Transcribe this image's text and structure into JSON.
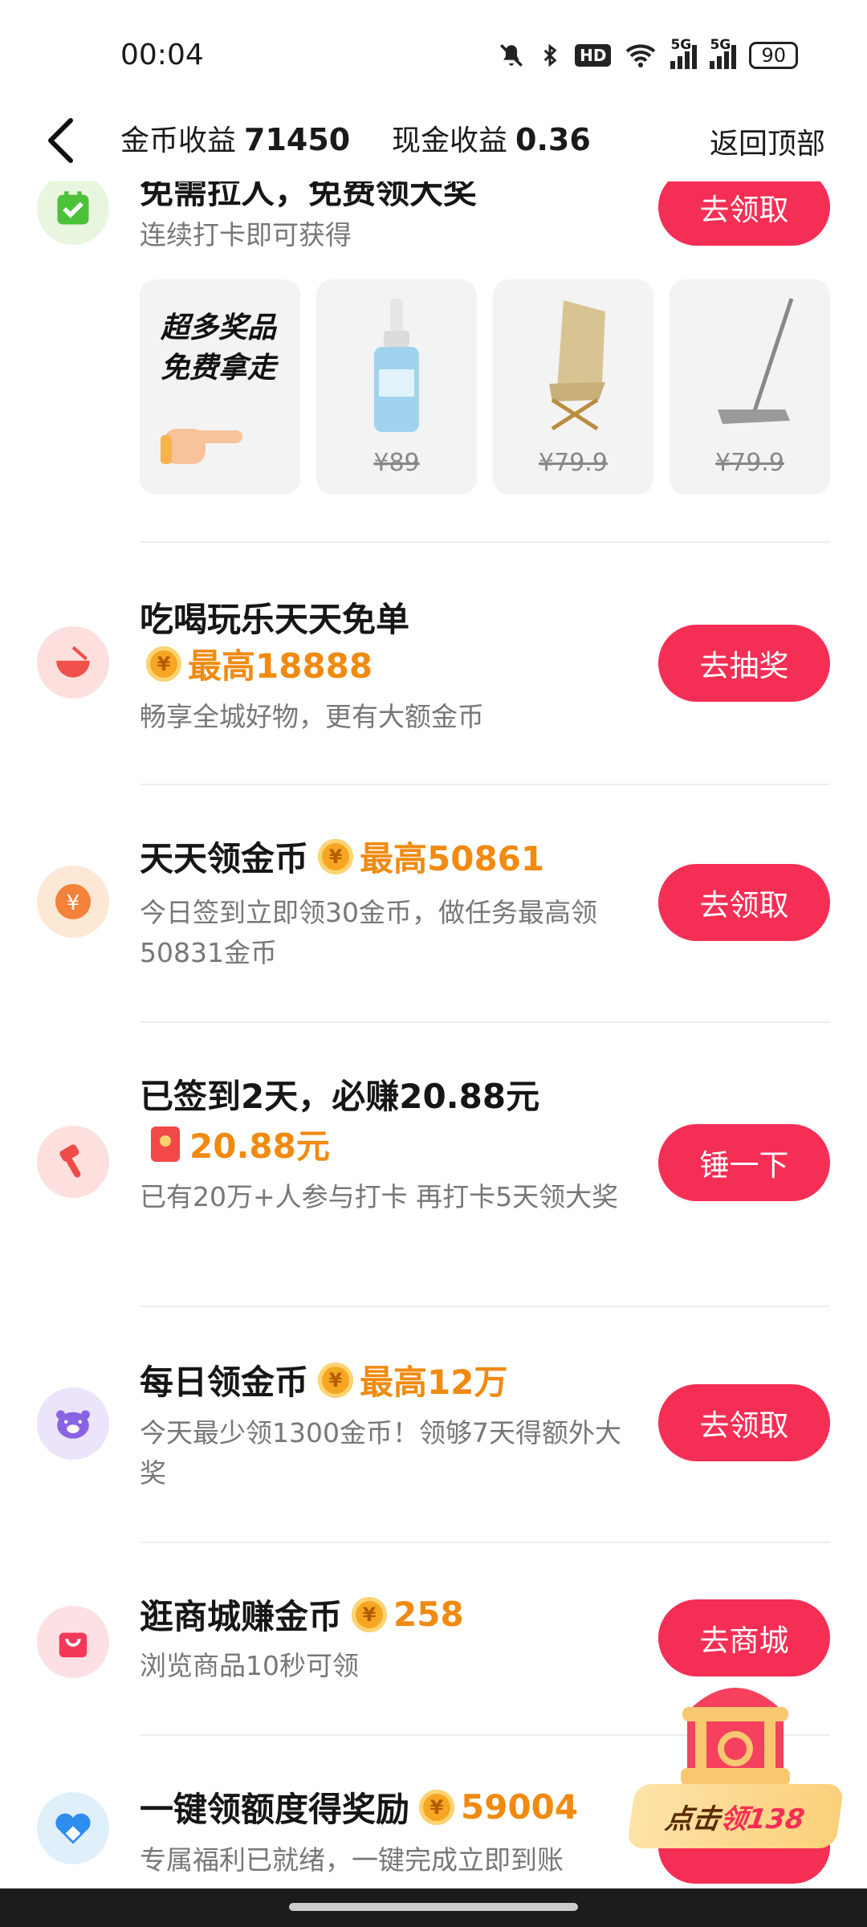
{
  "status_bar": {
    "time": "00:04",
    "battery": "90",
    "hd_label": "HD",
    "net1": "5G",
    "net2": "5G"
  },
  "header": {
    "coin_label": "金币收益",
    "coin_value": "71450",
    "cash_label": "现金收益",
    "cash_value": "0.36",
    "back_to_top": "返回顶部"
  },
  "tasks": [
    {
      "title": "免需拉人，免费领大奖",
      "desc": "连续打卡即可获得",
      "button": "去领取"
    },
    {
      "title": "吃喝玩乐天天免单",
      "highlight": "最高18888",
      "desc": "畅享全城好物，更有大额金币",
      "button": "去抽奖"
    },
    {
      "title": "天天领金币",
      "highlight": "最高50861",
      "desc": "今日签到立即领30金币，做任务最高领50831金币",
      "button": "去领取"
    },
    {
      "title": "已签到2天，必赚20.88元",
      "highlight": "20.88元",
      "desc": "已有20万+人参与打卡 再打卡5天领大奖",
      "button": "锤一下"
    },
    {
      "title": "每日领金币",
      "highlight": "最高12万",
      "desc": "今天最少领1300金币！领够7天得额外大奖",
      "button": "去领取"
    },
    {
      "title": "逛商城赚金币",
      "highlight": "258",
      "desc": "浏览商品10秒可领",
      "button": "去商城"
    },
    {
      "title": "一键领额度得奖励",
      "highlight": "59004",
      "desc": "专属福利已就绪，一键完成立即到账"
    }
  ],
  "products": {
    "promo_line1": "超多奖品",
    "promo_line2": "免费拿走",
    "items": [
      {
        "price": "¥89"
      },
      {
        "price": "¥79.9"
      },
      {
        "price": "¥79.9"
      }
    ]
  },
  "coin_glyph": "¥",
  "floating": {
    "prefix": "点击",
    "action": "领138"
  },
  "colors": {
    "accent": "#f52e55",
    "highlight": "#f08a10"
  }
}
